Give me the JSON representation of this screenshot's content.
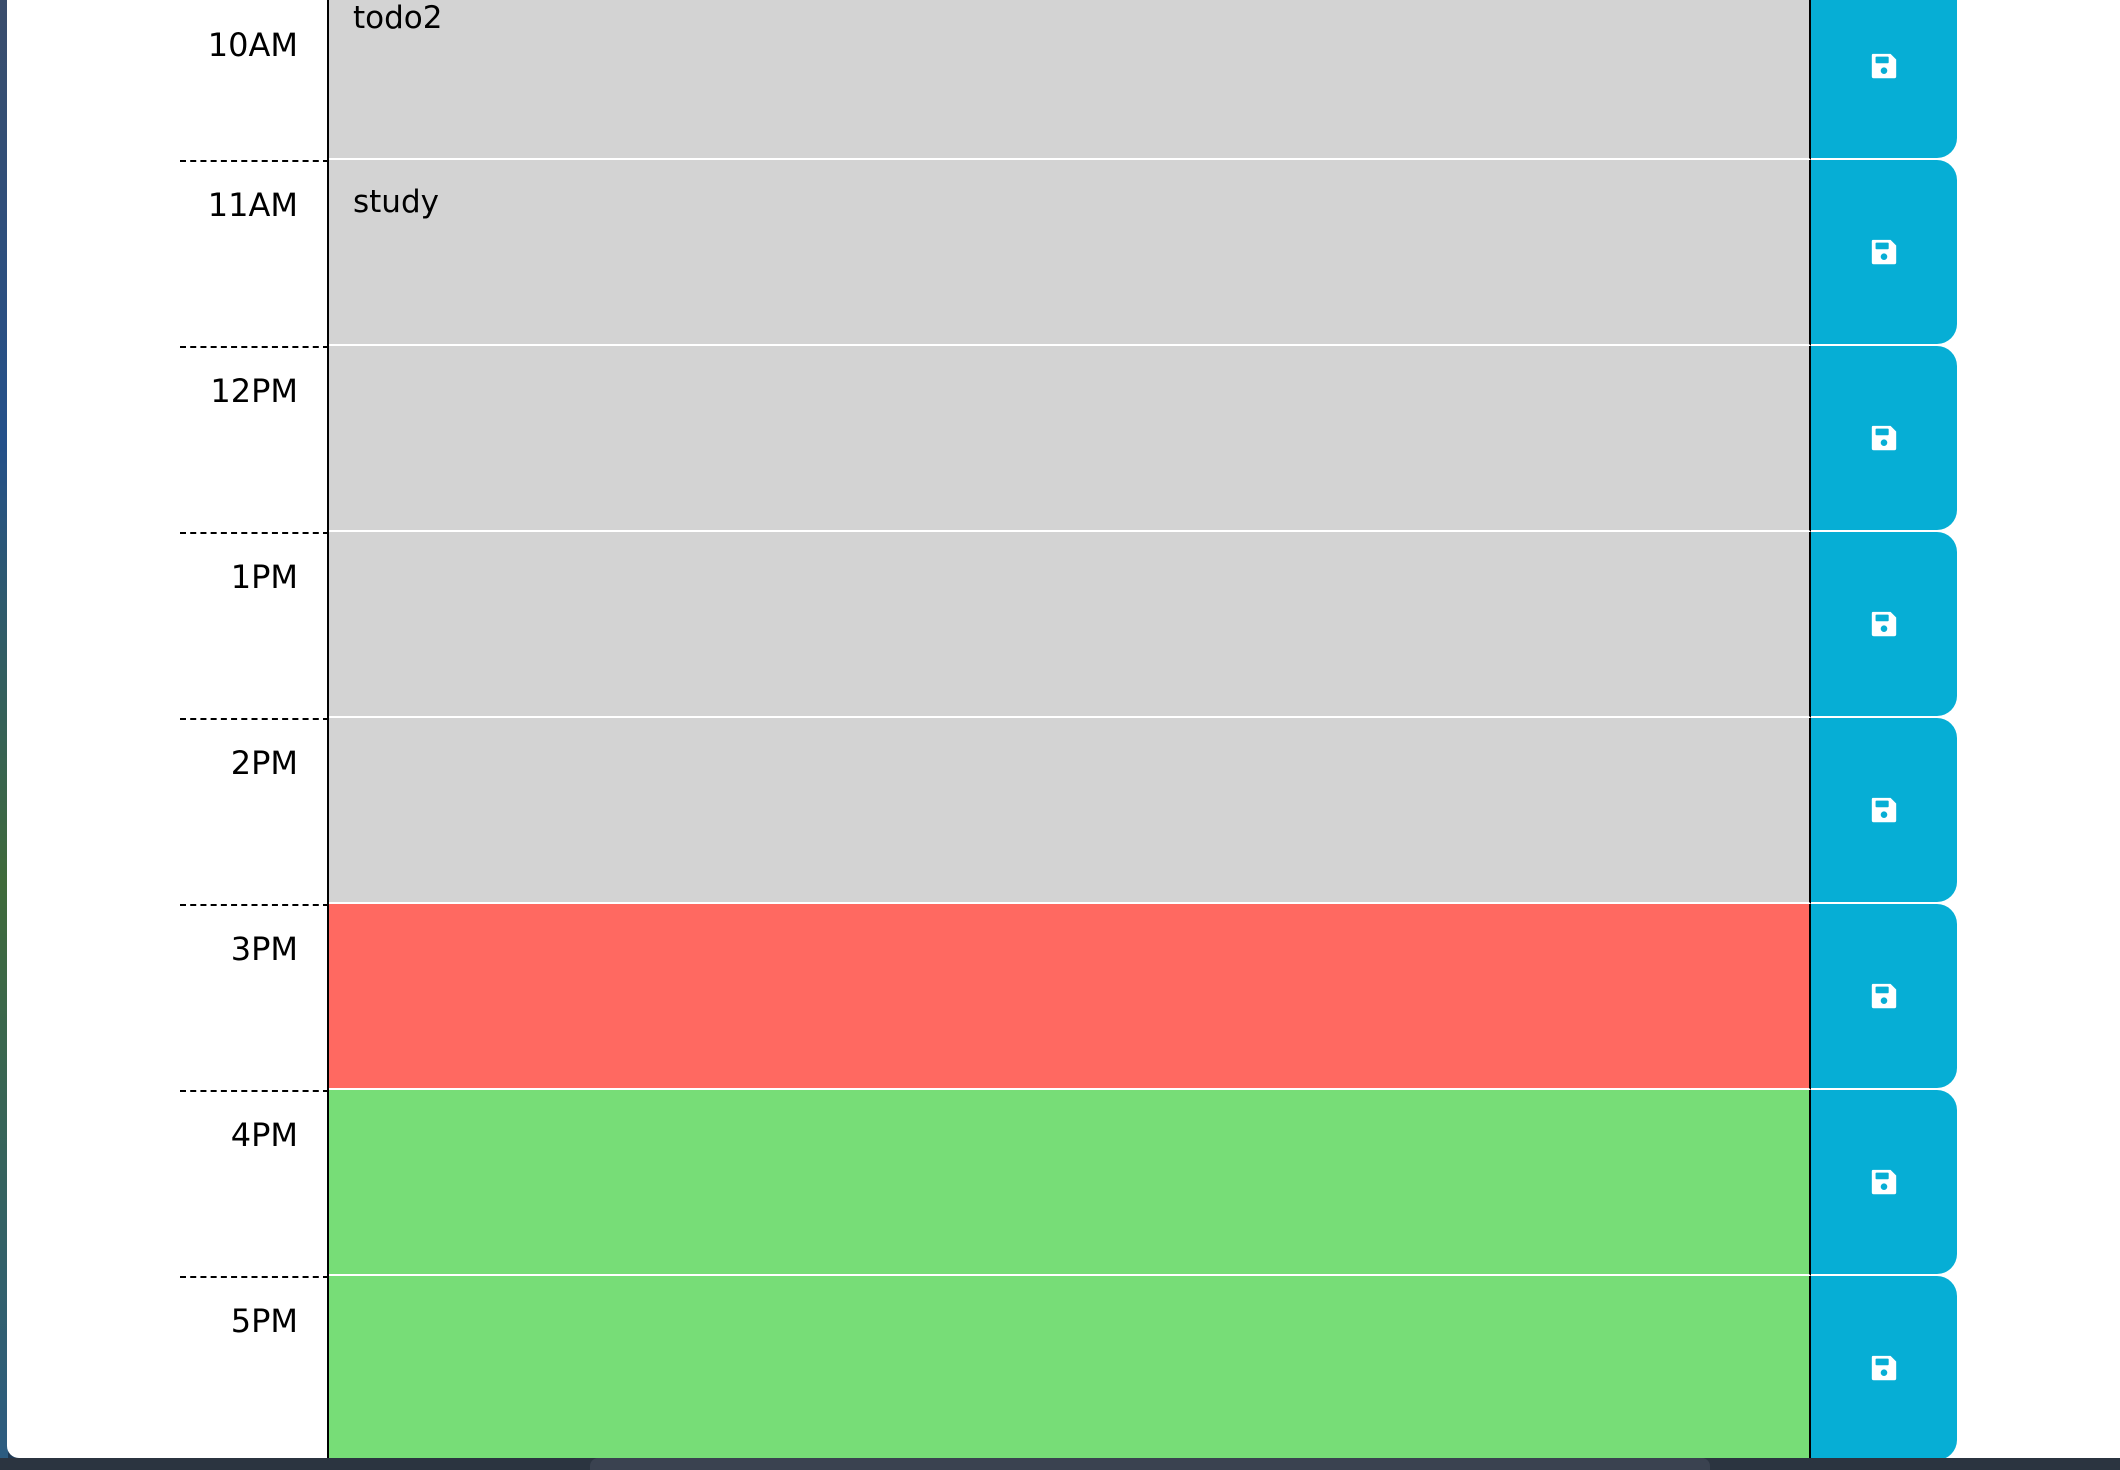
{
  "rows": [
    {
      "hour": "10AM",
      "text": "todo2",
      "state": "past"
    },
    {
      "hour": "11AM",
      "text": "study",
      "state": "past"
    },
    {
      "hour": "12PM",
      "text": "",
      "state": "past"
    },
    {
      "hour": "1PM",
      "text": "",
      "state": "past"
    },
    {
      "hour": "2PM",
      "text": "",
      "state": "past"
    },
    {
      "hour": "3PM",
      "text": "",
      "state": "present"
    },
    {
      "hour": "4PM",
      "text": "",
      "state": "future"
    },
    {
      "hour": "5PM",
      "text": "",
      "state": "future"
    }
  ],
  "colors": {
    "past": "#d3d3d3",
    "present": "#ff6961",
    "future": "#77dd77",
    "save_button": "#06aed5"
  },
  "icons": {
    "save": "floppy-disk-icon"
  }
}
